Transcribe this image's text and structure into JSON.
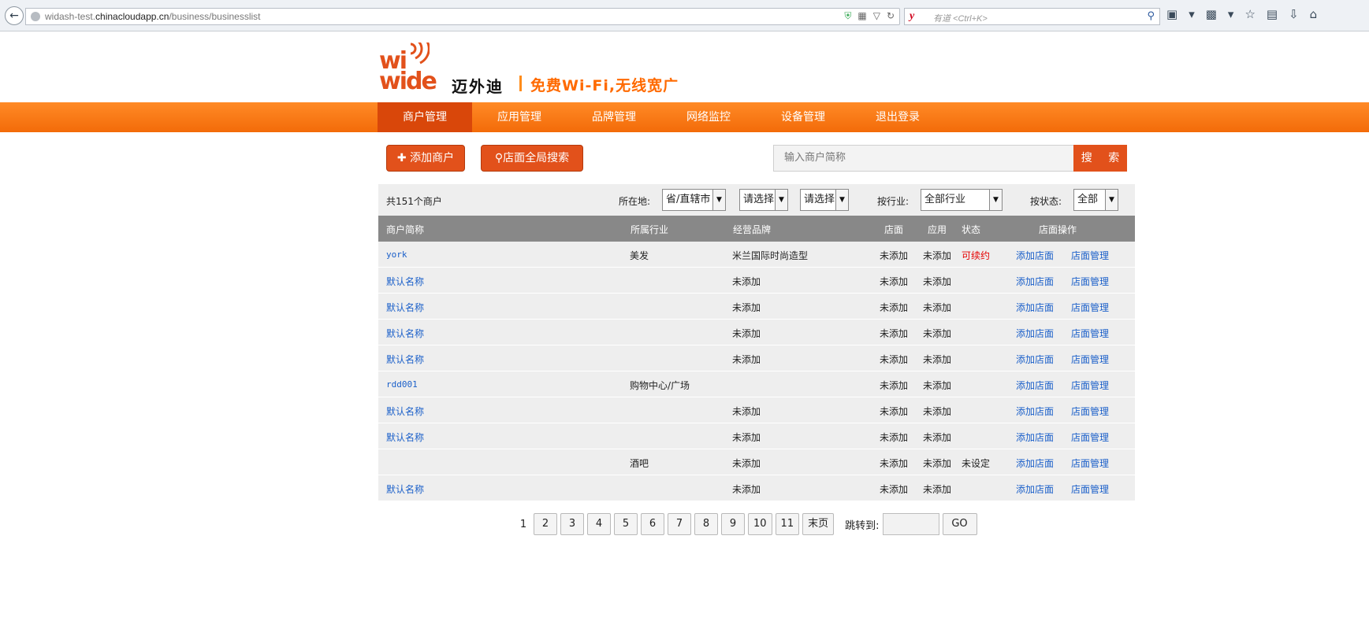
{
  "browser": {
    "url_prefix": "widash-test.",
    "url_domain": "chinacloudapp.cn",
    "url_path": "/business/businesslist",
    "search_placeholder": "有道 <Ctrl+K>"
  },
  "brand": {
    "logo_wi": "wi",
    "logo_wide": "wide",
    "name": "迈外迪",
    "slogan": "免费Wi-Fi,无线宽广"
  },
  "nav": {
    "items": [
      "商户管理",
      "应用管理",
      "品牌管理",
      "网络监控",
      "设备管理",
      "退出登录"
    ],
    "active": 0
  },
  "actions": {
    "add_merchant": "添加商户",
    "store_search": "店面全局搜索",
    "search_placeholder": "输入商户简称",
    "search_button": "搜 索"
  },
  "filters": {
    "count_text": "共151个商户",
    "location_label": "所在地:",
    "province": "省/直辖市",
    "city": "请选择",
    "district": "请选择",
    "industry_label": "按行业:",
    "industry": "全部行业",
    "status_label": "按状态:",
    "status": "全部"
  },
  "table": {
    "headers": [
      "商户简称",
      "所属行业",
      "经营品牌",
      "店面",
      "应用",
      "状态",
      "店面操作"
    ],
    "rows": [
      {
        "name": "york",
        "industry": "美发",
        "brand": "米兰国际时尚造型",
        "store": "未添加",
        "app": "未添加",
        "status": "可续约",
        "op1": "添加店面",
        "op2": "店面管理"
      },
      {
        "name": "默认名称",
        "industry": "",
        "brand": "未添加",
        "store": "未添加",
        "app": "未添加",
        "status": "",
        "op1": "添加店面",
        "op2": "店面管理"
      },
      {
        "name": "默认名称",
        "industry": "",
        "brand": "未添加",
        "store": "未添加",
        "app": "未添加",
        "status": "",
        "op1": "添加店面",
        "op2": "店面管理"
      },
      {
        "name": "默认名称",
        "industry": "",
        "brand": "未添加",
        "store": "未添加",
        "app": "未添加",
        "status": "",
        "op1": "添加店面",
        "op2": "店面管理"
      },
      {
        "name": "默认名称",
        "industry": "",
        "brand": "未添加",
        "store": "未添加",
        "app": "未添加",
        "status": "",
        "op1": "添加店面",
        "op2": "店面管理"
      },
      {
        "name": "rdd001",
        "industry": "购物中心/广场",
        "brand": "",
        "store": "未添加",
        "app": "未添加",
        "status": "",
        "op1": "添加店面",
        "op2": "店面管理"
      },
      {
        "name": "默认名称",
        "industry": "",
        "brand": "未添加",
        "store": "未添加",
        "app": "未添加",
        "status": "",
        "op1": "添加店面",
        "op2": "店面管理"
      },
      {
        "name": "默认名称",
        "industry": "",
        "brand": "未添加",
        "store": "未添加",
        "app": "未添加",
        "status": "",
        "op1": "添加店面",
        "op2": "店面管理"
      },
      {
        "name": "",
        "industry": "酒吧",
        "brand": "未添加",
        "store": "未添加",
        "app": "未添加",
        "status": "未设定",
        "op1": "添加店面",
        "op2": "店面管理"
      },
      {
        "name": "默认名称",
        "industry": "",
        "brand": "未添加",
        "store": "未添加",
        "app": "未添加",
        "status": "",
        "op1": "添加店面",
        "op2": "店面管理"
      }
    ]
  },
  "pagination": {
    "current": "1",
    "pages": [
      "2",
      "3",
      "4",
      "5",
      "6",
      "7",
      "8",
      "9",
      "10",
      "11"
    ],
    "last": "末页",
    "jump_label": "跳转到:",
    "go": "GO"
  },
  "colors": {
    "brand_orange": "#e2511b",
    "nav_orange": "#f36b09",
    "link_blue": "#1a5fc9",
    "status_red": "#e60000"
  }
}
